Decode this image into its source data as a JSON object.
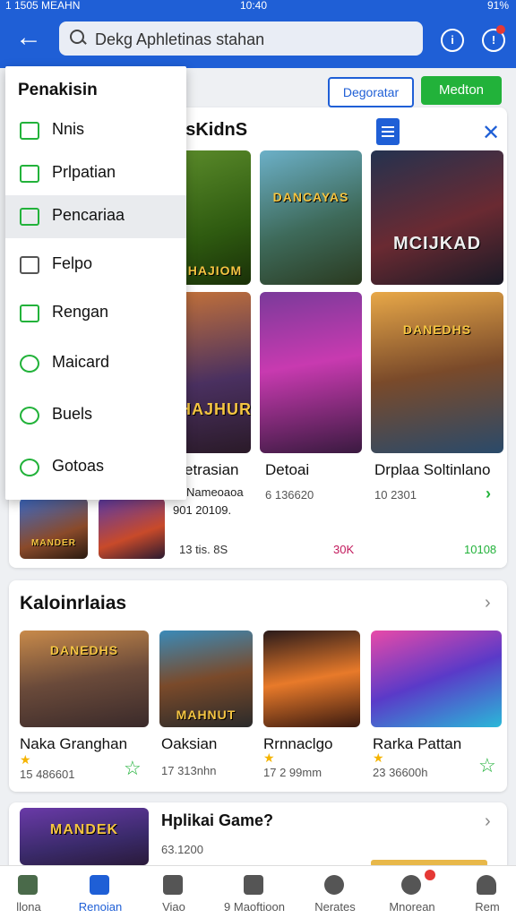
{
  "status": {
    "left": "1 1505 MEAHN",
    "time": "10:40",
    "right": "91%"
  },
  "search": {
    "value": "Dekg Aphletinas stahan"
  },
  "actions": {
    "outline_button": "Degoratar",
    "green_button": "Medton"
  },
  "dropdown": {
    "title": "Penakisin",
    "items": [
      {
        "label": "Nnis",
        "icon": "wallet-icon"
      },
      {
        "label": "Prlpatian",
        "icon": "image-icon"
      },
      {
        "label": "Pencariaa",
        "icon": "checklist-icon"
      },
      {
        "label": "Felpo",
        "icon": "clapper-icon"
      },
      {
        "label": "Rengan",
        "icon": "book-icon"
      },
      {
        "label": "Maicard",
        "icon": "chat-icon"
      },
      {
        "label": "Buels",
        "icon": "chat-icon"
      },
      {
        "label": "Gotoas",
        "icon": "chat-icon"
      }
    ]
  },
  "section1": {
    "heading": "nsKidnS",
    "images": [
      {
        "caption": "HAJIOM"
      },
      {
        "caption": "DANCAYAS"
      },
      {
        "caption": "MCIJKAD"
      },
      {
        "caption": "HAJHUR"
      },
      {
        "caption": ""
      },
      {
        "caption": "DANEDHS"
      },
      {
        "caption": "MANDER"
      },
      {
        "caption": ""
      }
    ],
    "games": [
      {
        "title": "etrasian",
        "meta": "Nameoaoa",
        "meta2": "901 20109.",
        "rating": "13 tis. 8S"
      },
      {
        "title": "Detoai",
        "meta": "6 136620",
        "rating": "30K"
      },
      {
        "title": "Drplaa Soltinlano",
        "meta": "10 2301",
        "rating": "10108"
      }
    ]
  },
  "section2": {
    "heading": "Kaloinrlaias",
    "games": [
      {
        "title": "Naka Granghan",
        "meta": "15 486601",
        "caption": "DANEDHS"
      },
      {
        "title": "Oaksian",
        "meta": "17 313nhn",
        "caption": "MAHNUT"
      },
      {
        "title": "Rrnnaclgo",
        "meta": "17 2 99mm",
        "caption": ""
      },
      {
        "title": "Rarka Pattan",
        "meta": "23 36600h",
        "caption": ""
      }
    ]
  },
  "section3": {
    "heading": "Hplikai Game?",
    "meta": "63.1200",
    "caption": "MANDEK"
  },
  "bottom_nav": [
    {
      "label": "llona",
      "icon": "home-icon"
    },
    {
      "label": "Renoian",
      "icon": "flag-icon",
      "active": true
    },
    {
      "label": "Viao",
      "icon": "shield-icon"
    },
    {
      "label": "9 Maoftioon",
      "icon": "lock-icon"
    },
    {
      "label": "Nerates",
      "icon": "paw-icon"
    },
    {
      "label": "Mnorean",
      "icon": "bell-icon"
    },
    {
      "label": "Rem",
      "icon": "user-icon"
    }
  ],
  "colors": {
    "primary": "#1f5fd6",
    "green": "#22b23a",
    "red": "#e53935"
  }
}
